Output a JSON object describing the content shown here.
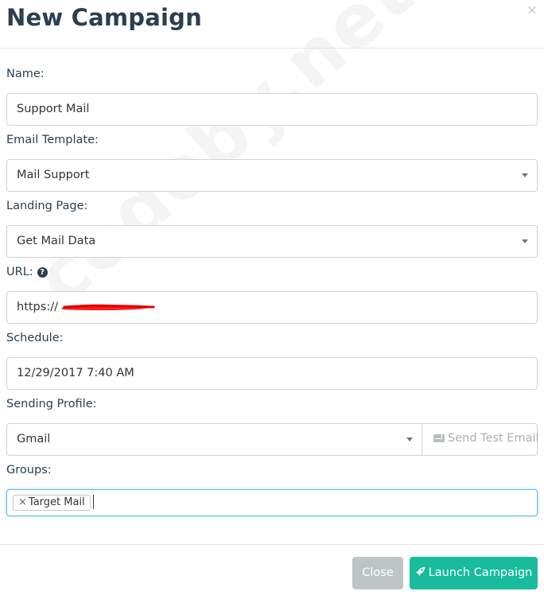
{
  "modal": {
    "title": "New Campaign",
    "close_glyph": "×"
  },
  "fields": {
    "name": {
      "label": "Name:",
      "value": "Support Mail"
    },
    "email_template": {
      "label": "Email Template:",
      "value": "Mail Support"
    },
    "landing_page": {
      "label": "Landing Page:",
      "value": "Get Mail Data"
    },
    "url": {
      "label": "URL:",
      "value": "https://",
      "help_glyph": "?"
    },
    "schedule": {
      "label": "Schedule:",
      "value": "12/29/2017 7:40 AM"
    },
    "sending_profile": {
      "label": "Sending Profile:",
      "value": "Gmail",
      "send_test_label": "Send Test Email"
    },
    "groups": {
      "label": "Groups:",
      "tags": [
        {
          "remove_glyph": "×",
          "label": "Target Mail"
        }
      ]
    }
  },
  "footer": {
    "close_label": "Close",
    "launch_label": "Launch Campaign"
  },
  "watermark": "codeby.net",
  "colors": {
    "accent": "#18bc9c",
    "heading": "#2c3e50",
    "focus_border": "#5bc0de",
    "redaction": "#ff0000",
    "close_button": "#bfc4c6"
  },
  "icons": [
    "close-icon",
    "question-circle-icon",
    "chevron-down-icon",
    "envelope-icon",
    "rocket-icon"
  ]
}
